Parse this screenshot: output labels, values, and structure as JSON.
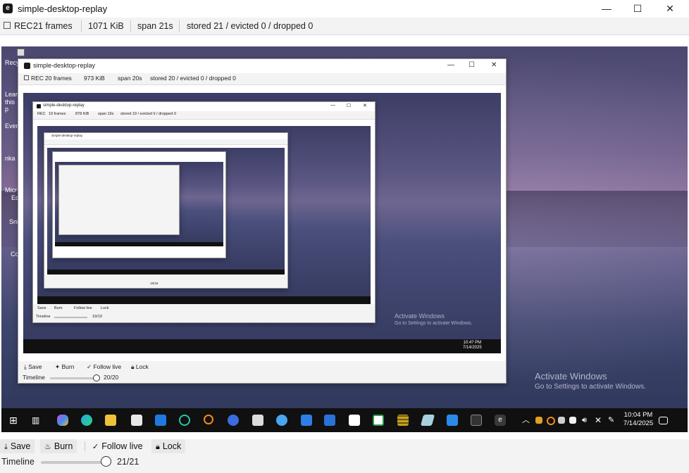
{
  "window": {
    "title": "simple-desktop-replay",
    "app_icon_glyph": "e",
    "minimize_glyph": "—",
    "maximize_glyph": "☐",
    "close_glyph": "✕"
  },
  "status": {
    "rec_label": "REC",
    "frames": "21 frames",
    "size": "1071 KiB",
    "span": "span 21s",
    "stored": "stored 21 / evicted 0 / dropped 0"
  },
  "controls": {
    "save_label": "Save",
    "burn_label": "Burn",
    "follow_label": "Follow live",
    "lock_label": "Lock",
    "timeline_label": "Timeline",
    "timeline_count": "21/21",
    "timeline_position": 1.0
  },
  "desktop": {
    "icon_labels": [
      "Recy",
      "Learn",
      "this p",
      "Ever",
      "nka",
      "Micr",
      "Ed",
      "Sni",
      "Co"
    ],
    "activate_title": "Activate Windows",
    "activate_sub": "Go to Settings to activate Windows.",
    "clock_time": "10:04 PM",
    "clock_date": "7/14/2025"
  },
  "nested1": {
    "title": "simple-desktop-replay",
    "rec_label": "REC",
    "frames": "20 frames",
    "size": "973 KiB",
    "span": "span 20s",
    "stored": "stored 20 / evicted 0 / dropped 0",
    "save_label": "Save",
    "burn_label": "Burn",
    "follow_label": "Follow live",
    "lock_label": "Lock",
    "timeline_label": "Timeline",
    "timeline_count": "20/20",
    "activate_title": "Activate Windows",
    "activate_sub": "Go to Settings to activate Windows.",
    "clock_time": "10:4? PM",
    "clock_date": "7/14/2025"
  },
  "nested2": {
    "title": "simple-desktop-replay",
    "rec_label": "REC",
    "frames": "19 frames",
    "size": "878 KiB",
    "span": "span 19s",
    "stored": "stored 19 / evicted 0 / dropped 0",
    "save_label": "Save",
    "burn_label": "Burn",
    "follow_label": "Follow live",
    "lock_label": "Lock",
    "timeline_label": "Timeline",
    "timeline_count": "19/19"
  },
  "nested3": {
    "title": "simple-desktop-replay",
    "timeline_count": "18/18"
  },
  "colors": {
    "taskbar": "#101010",
    "chrome": "#f3f3f3"
  }
}
